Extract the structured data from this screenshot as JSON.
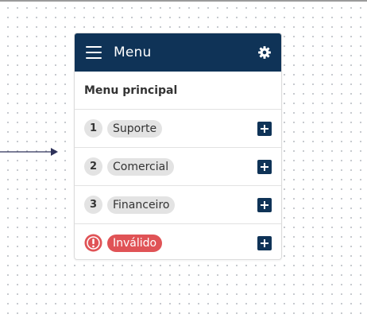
{
  "card": {
    "title": "Menu",
    "section_title": "Menu principal"
  },
  "items": [
    {
      "number": "1",
      "label": "Suporte"
    },
    {
      "number": "2",
      "label": "Comercial"
    },
    {
      "number": "3",
      "label": "Financeiro"
    }
  ],
  "invalid_item": {
    "label": "Inválido"
  },
  "icons": {
    "menu": "hamburger-menu-icon",
    "settings": "gear-icon",
    "add": "plus-icon",
    "error": "exclamation-circle-icon",
    "connector": "arrow-right-icon"
  },
  "colors": {
    "header": "#0f3357",
    "pill": "#e3e3e3",
    "error": "#e05356",
    "connector": "#2d3159"
  }
}
